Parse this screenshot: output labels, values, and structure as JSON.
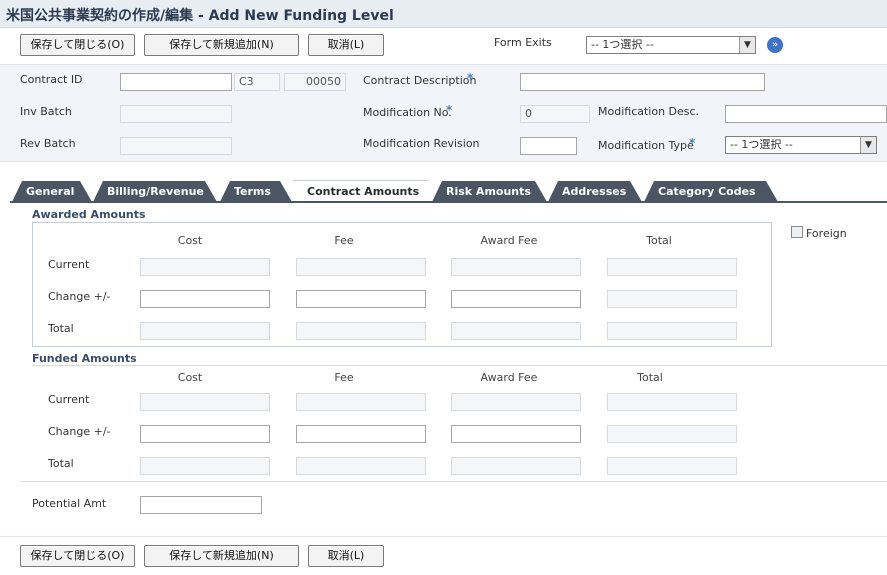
{
  "window": {
    "title": "米国公共事業契約の作成/編集 - Add New Funding Level"
  },
  "toolbar": {
    "save_close": "保存して閉じる(O)",
    "save_new": "保存して新規追加(N)",
    "cancel": "取消(L)",
    "form_exits_label": "Form Exits",
    "form_exits_value": "-- 1つ選択 --"
  },
  "header": {
    "contract_id_label": "Contract ID",
    "contract_id_value": "",
    "contract_type": "C3",
    "contract_company": "00050",
    "contract_desc_label": "Contract Description",
    "contract_desc_value": "",
    "inv_batch_label": "Inv Batch",
    "inv_batch_value": "",
    "rev_batch_label": "Rev Batch",
    "rev_batch_value": "",
    "modification_no_label": "Modification No.",
    "modification_no_value": "0",
    "modification_desc_label": "Modification Desc.",
    "modification_desc_value": "",
    "modification_revision_label": "Modification Revision",
    "modification_revision_value": "",
    "modification_type_label": "Modification Type",
    "modification_type_value": "-- 1つ選択 --"
  },
  "tabs": [
    {
      "label": "General"
    },
    {
      "label": "Billing/Revenue"
    },
    {
      "label": "Terms"
    },
    {
      "label": "Contract Amounts"
    },
    {
      "label": "Risk Amounts"
    },
    {
      "label": "Addresses"
    },
    {
      "label": "Category Codes"
    }
  ],
  "awarded": {
    "title": "Awarded Amounts",
    "columns": [
      "Cost",
      "Fee",
      "Award Fee",
      "Total"
    ],
    "rows": [
      "Current",
      "Change +/-",
      "Total"
    ]
  },
  "funded": {
    "title": "Funded Amounts",
    "columns": [
      "Cost",
      "Fee",
      "Award Fee",
      "Total"
    ],
    "rows": [
      "Current",
      "Change +/-",
      "Total"
    ]
  },
  "foreign_label": "Foreign",
  "foreign_checked": false,
  "potential_amt_label": "Potential Amt",
  "potential_amt_value": ""
}
